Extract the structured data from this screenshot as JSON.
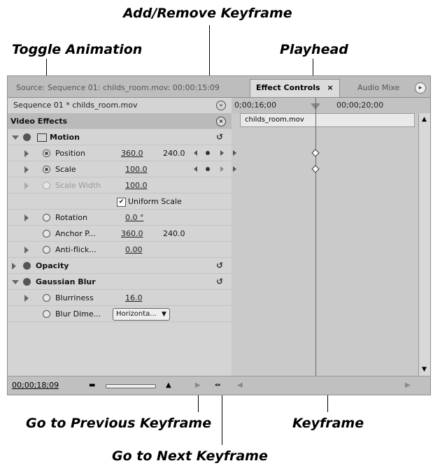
{
  "callouts": {
    "add_remove_keyframe": "Add/Remove Keyframe",
    "toggle_animation": "Toggle Animation",
    "playhead": "Playhead",
    "go_prev_keyframe": "Go to Previous Keyframe",
    "keyframe": "Keyframe",
    "go_next_keyframe": "Go to Next Keyframe"
  },
  "tabs": {
    "source": "Source: Sequence 01: childs_room.mov: 00:00:15:09",
    "effect_controls": "Effect Controls",
    "effect_controls_close": "×",
    "audio_mixer": "Audio Mixe"
  },
  "sequence_label": "Sequence 01 * childs_room.mov",
  "timeline": {
    "time_start": "0;00;16;00",
    "time_end": "00;00;20;00",
    "clip_name": "childs_room.mov",
    "timecode": "00;00;18;09"
  },
  "rows": {
    "video_effects": "Video Effects",
    "motion": "Motion",
    "position": "Position",
    "position_x": "360.0",
    "position_y": "240.0",
    "scale": "Scale",
    "scale_val": "100.0",
    "scale_width": "Scale Width",
    "scale_width_val": "100.0",
    "uniform_scale": "Uniform Scale",
    "rotation": "Rotation",
    "rotation_val": "0.0 °",
    "anchor_point": "Anchor P...",
    "anchor_x": "360.0",
    "anchor_y": "240.0",
    "anti_flicker": "Anti-flick...",
    "anti_flicker_val": "0.00",
    "opacity": "Opacity",
    "gaussian_blur": "Gaussian Blur",
    "blurriness": "Blurriness",
    "blurriness_val": "16.0",
    "blur_dimensions": "Blur Dime...",
    "blur_dim_value": "Horizonta..."
  },
  "icons": {
    "keyframe": "diamond",
    "stopwatch": "stopwatch-icon",
    "reset": "reset-icon"
  }
}
